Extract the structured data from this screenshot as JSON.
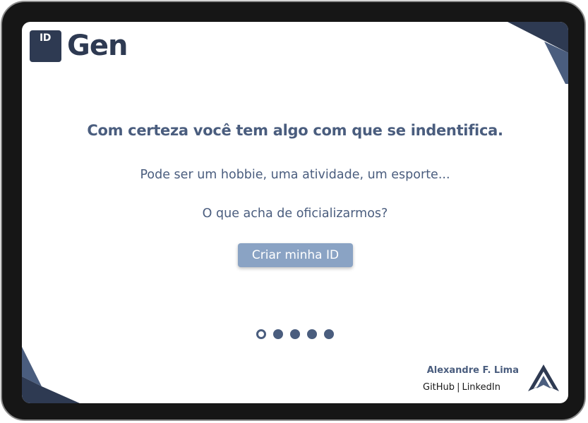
{
  "app": {
    "logo_badge": "ID",
    "logo_text": "Gen"
  },
  "main": {
    "headline": "Com certeza você tem algo com que se indentifica.",
    "paragraph_1": "Pode ser um hobbie, uma atividade, um esporte...",
    "paragraph_2": "O que acha de oficializarmos?",
    "cta_label": "Criar minha ID"
  },
  "pagination": {
    "total": 5,
    "active_index": 0
  },
  "footer": {
    "author": "Alexandre F. Lima",
    "link_github": "GitHub",
    "separator": "|",
    "link_linkedin": "LinkedIn",
    "brand_icon": "chevron-up-logo-icon"
  },
  "colors": {
    "primary_dark": "#2e3a52",
    "primary": "#4a5d7e",
    "button_bg": "#8aa3c4",
    "device_frame": "#161616"
  }
}
